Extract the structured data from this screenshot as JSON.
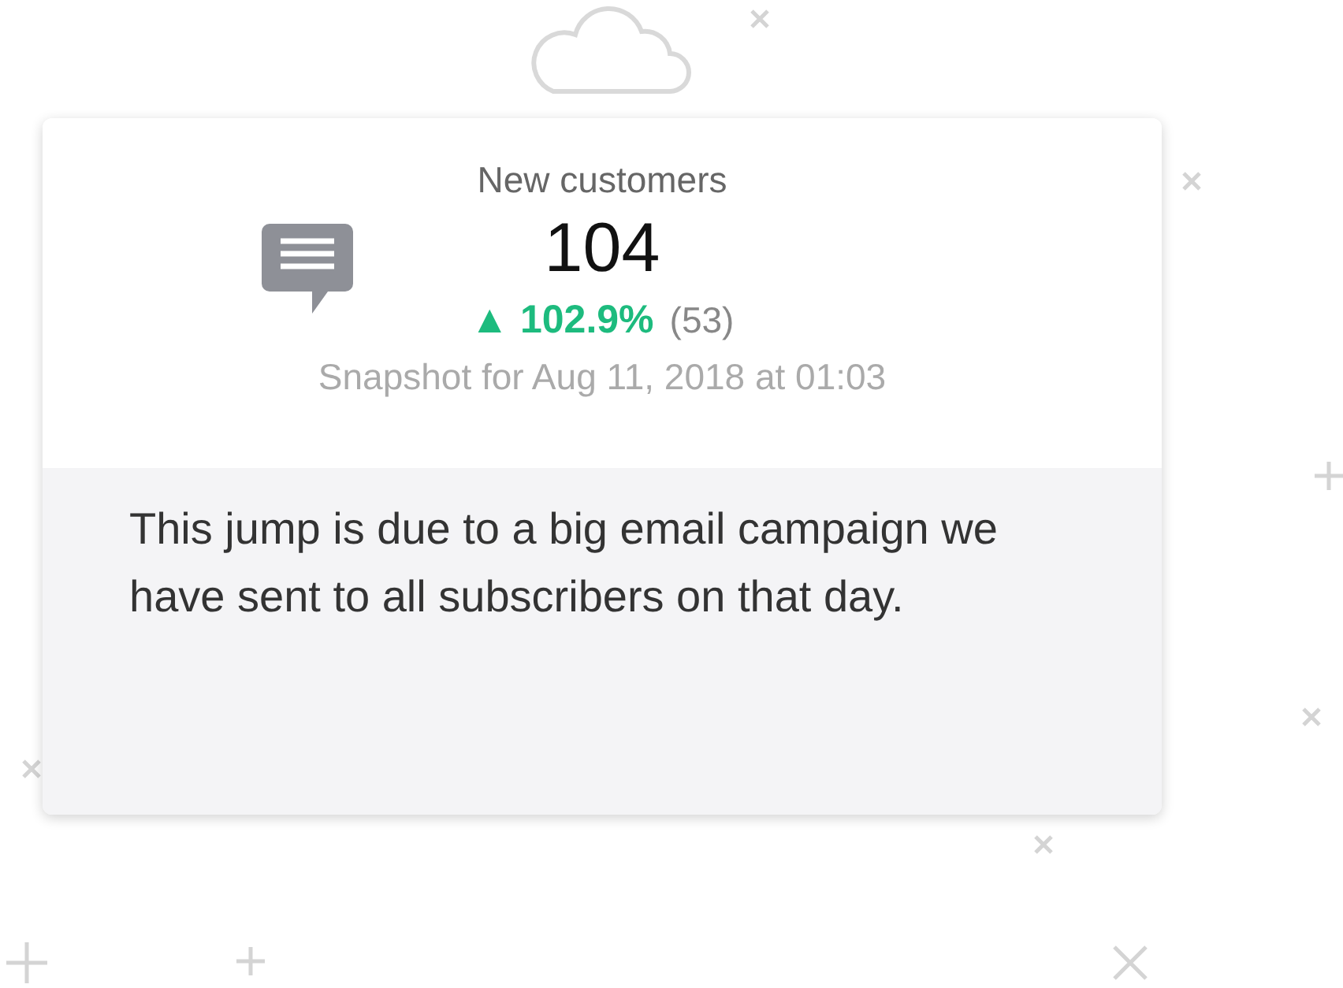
{
  "card": {
    "title": "New customers",
    "value": "104",
    "change": {
      "arrow": "▲",
      "percent": "102.9%",
      "previous": "(53)"
    },
    "snapshot": "Snapshot for Aug 11, 2018 at 01:03",
    "note": "This jump is due to a big email campaign we have sent to all subscribers on that day."
  }
}
